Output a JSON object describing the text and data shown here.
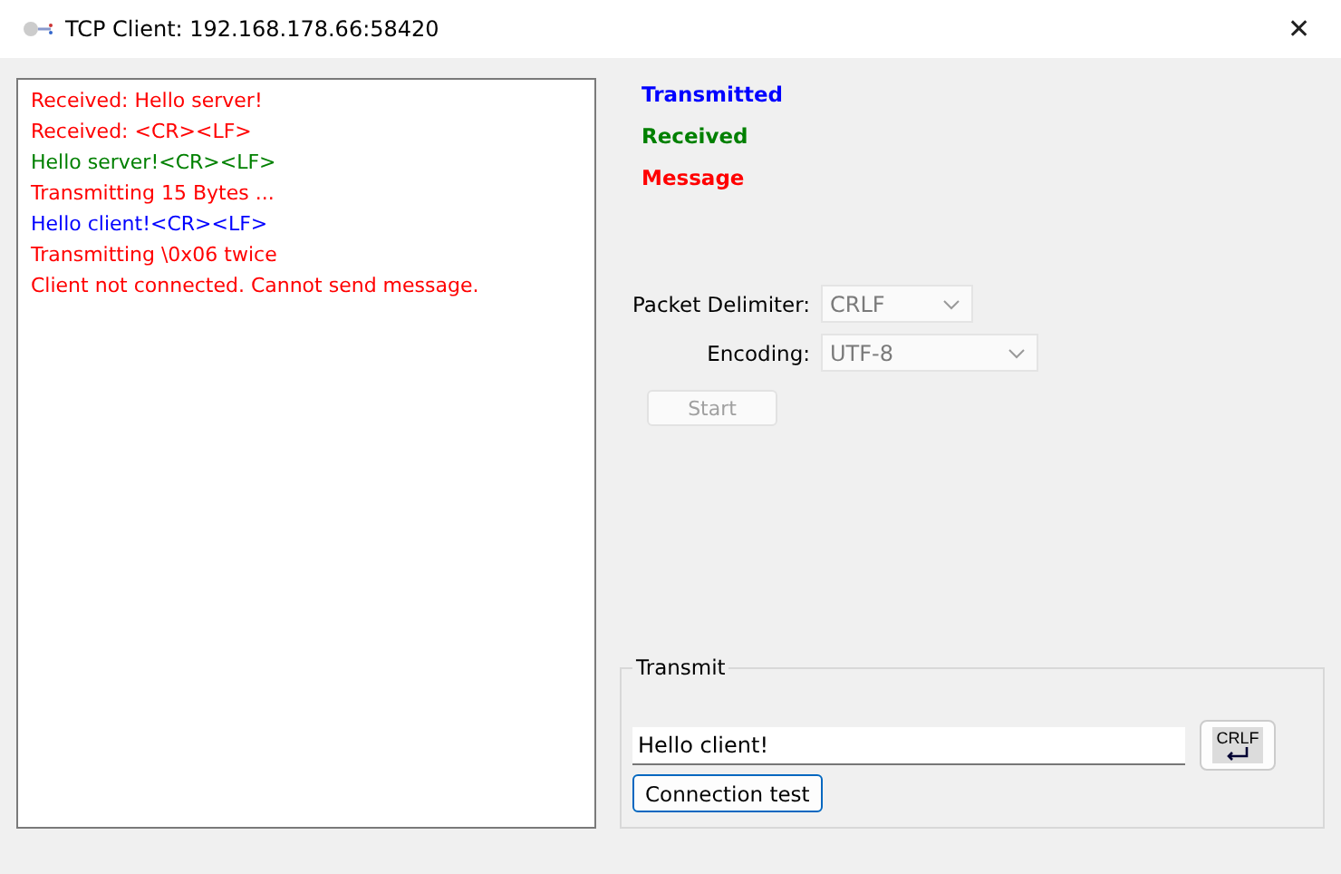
{
  "window": {
    "title": "TCP Client: 192.168.178.66:58420",
    "close": "✕"
  },
  "log": [
    {
      "text": "Received: Hello server!",
      "color": "#ff0000"
    },
    {
      "text": "Received: <CR><LF>",
      "color": "#ff0000"
    },
    {
      "text": "Hello server!<CR><LF>",
      "color": "#008000"
    },
    {
      "text": "Transmitting 15 Bytes ...",
      "color": "#ff0000"
    },
    {
      "text": "Hello client!<CR><LF>",
      "color": "#0000ff"
    },
    {
      "text": "Transmitting \\0x06 twice",
      "color": "#ff0000"
    },
    {
      "text": "Client not connected. Cannot send message.",
      "color": "#ff0000"
    }
  ],
  "legend": [
    {
      "text": "Transmitted",
      "color": "#0000ff"
    },
    {
      "text": "Received",
      "color": "#008000"
    },
    {
      "text": "Message",
      "color": "#ff0000"
    }
  ],
  "settings": [
    {
      "label": "Packet Delimiter:",
      "value": "CRLF",
      "disabled": true
    },
    {
      "label": "Encoding:",
      "value": "UTF-8",
      "disabled": true
    }
  ],
  "start_button": {
    "label": "Start",
    "disabled": true
  },
  "transmit": {
    "title": "Transmit",
    "value": "Hello client!",
    "crlf_label": "CRLF",
    "test_button": "Connection test"
  }
}
